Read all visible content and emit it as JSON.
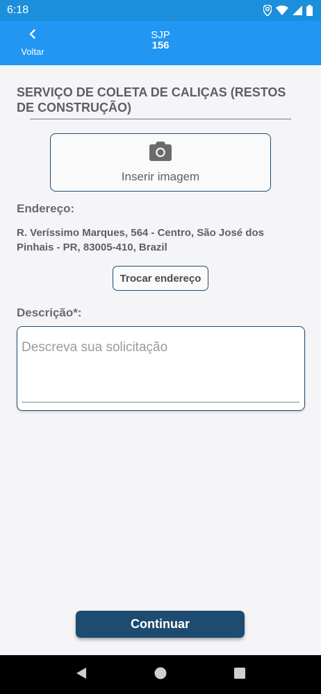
{
  "status_bar": {
    "time": "6:18",
    "icons": [
      "location-icon",
      "wifi-icon",
      "signal-icon",
      "battery-icon"
    ]
  },
  "app_bar": {
    "back_label": "Voltar",
    "title_line1": "SJP",
    "title_line2": "156",
    "color": "#2196f3"
  },
  "form": {
    "service_title": "SERVIÇO DE COLETA DE CALIÇAS (RESTOS DE CONSTRUÇÃO)",
    "insert_image_label": "Inserir imagem",
    "address_label": "Endereço:",
    "address_text": "R. Veríssimo Marques, 564 - Centro, São José dos Pinhais - PR, 83005-410, Brazil",
    "change_address_label": "Trocar endereço",
    "description_label": "Descrição*:",
    "description_placeholder": "Descreva sua solicitação",
    "description_value": "",
    "continue_label": "Continuar",
    "accent_color": "#1e4c71"
  },
  "nav_bar": {
    "buttons": [
      "back-icon",
      "home-icon",
      "recents-icon"
    ]
  }
}
